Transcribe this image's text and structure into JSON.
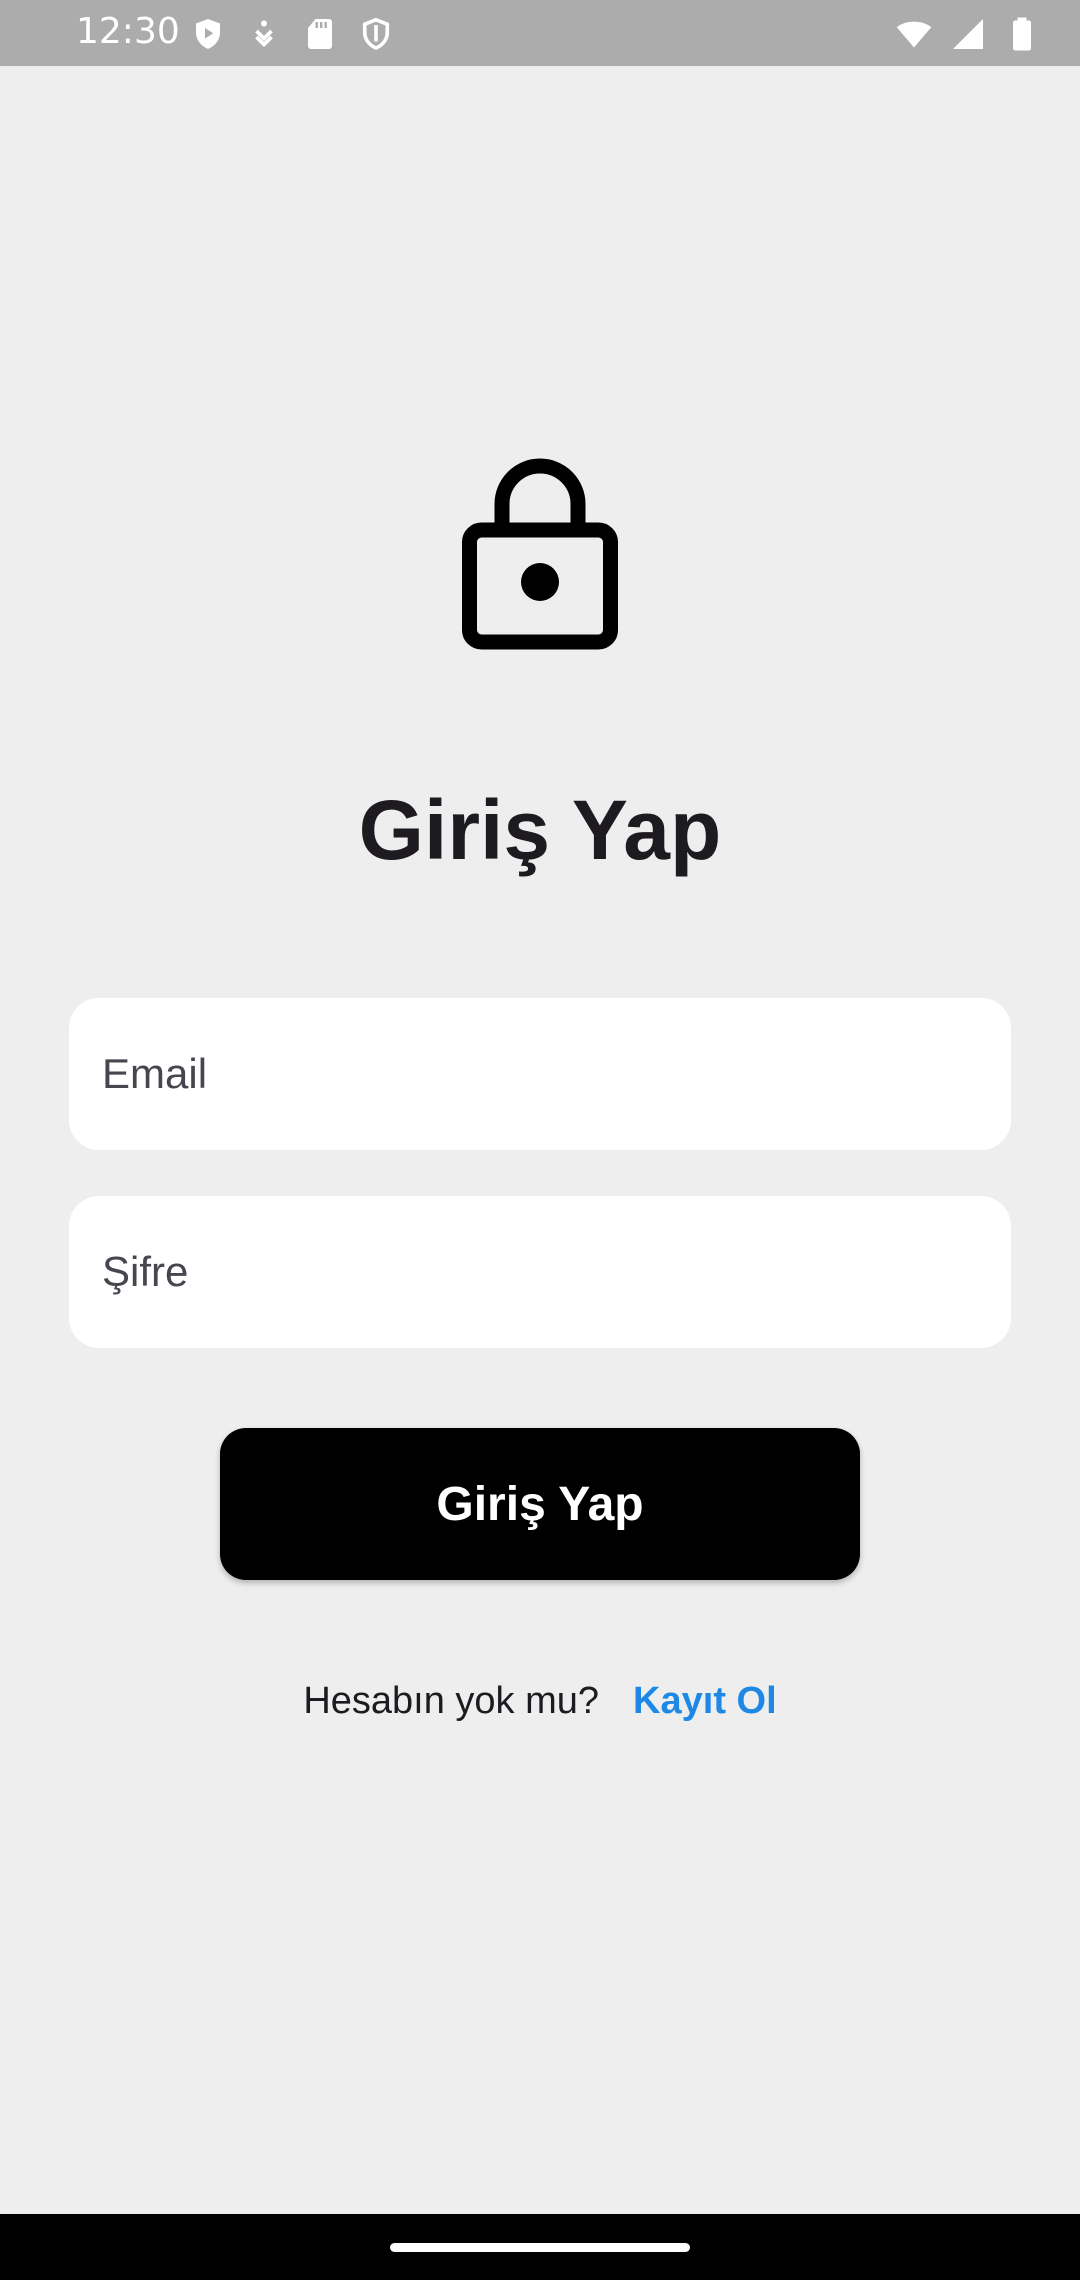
{
  "status_bar": {
    "time": "12:30",
    "left_icons": [
      "shield-play-icon",
      "download-icon",
      "sd-card-icon",
      "shield-outline-icon"
    ],
    "right_icons": [
      "wifi-icon",
      "signal-icon",
      "battery-icon"
    ]
  },
  "login": {
    "icon": "lock-icon",
    "title": "Giriş Yap",
    "email_placeholder": "Email",
    "password_placeholder": "Şifre",
    "submit_label": "Giriş Yap",
    "signup_prompt": "Hesabın yok mu?",
    "signup_link": "Kayıt Ol"
  },
  "colors": {
    "background": "#eeeeee",
    "button": "#000000",
    "link": "#1e88e5",
    "status_bar": "#acacac"
  }
}
